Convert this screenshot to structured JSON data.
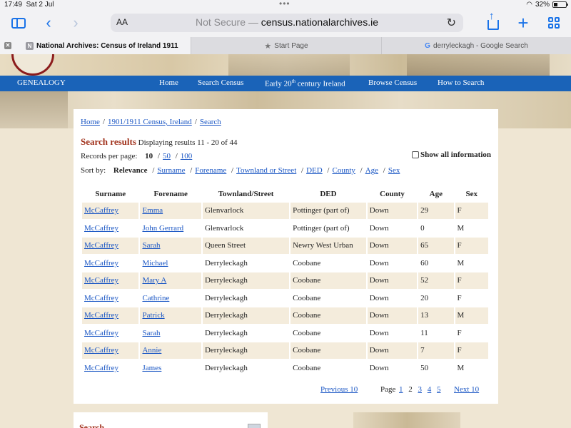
{
  "status_bar": {
    "time": "17:49",
    "date": "Sat 2 Jul",
    "battery": "32%"
  },
  "toolbar": {
    "aa_label": "AA",
    "url_prefix": "Not Secure —",
    "url_host": "census.nationalarchives.ie",
    "icons": [
      "sidebar-icon",
      "back-icon",
      "forward-icon",
      "reload-icon",
      "share-icon",
      "new-tab-icon",
      "tabs-overview-icon"
    ]
  },
  "tabs": [
    {
      "label": "National Archives: Census of Ireland 1911",
      "active": true
    },
    {
      "label": "Start Page",
      "active": false
    },
    {
      "label": "derryleckagh - Google Search",
      "active": false
    }
  ],
  "nav": {
    "genealogy": "GENEALOGY",
    "items": [
      "Home",
      "Search Census",
      "Early 20",
      "th",
      " century Ireland",
      "Browse Census",
      "How to Search"
    ]
  },
  "breadcrumb": [
    "Home",
    "1901/1911 Census, Ireland",
    "Search"
  ],
  "results": {
    "heading": "Search results",
    "info": "Displaying results 11 - 20 of 44"
  },
  "per_page": {
    "label": "Records per page:",
    "current": "10",
    "options": [
      "50",
      "100"
    ]
  },
  "show_all": "Show all information",
  "sort": {
    "label": "Sort by:",
    "current": "Relevance",
    "options": [
      "Surname",
      "Forename",
      "Townland or Street",
      "DED",
      "County",
      "Age",
      "Sex"
    ]
  },
  "table": {
    "headers": [
      "Surname",
      "Forename",
      "Townland/Street",
      "DED",
      "County",
      "Age",
      "Sex"
    ],
    "rows": [
      [
        "McCaffrey",
        "Emma",
        "Glenvarlock",
        "Pottinger (part of)",
        "Down",
        "29",
        "F"
      ],
      [
        "McCaffrey",
        "John Gerrard",
        "Glenvarlock",
        "Pottinger (part of)",
        "Down",
        "0",
        "M"
      ],
      [
        "McCaffrey",
        "Sarah",
        "Queen Street",
        "Newry West Urban",
        "Down",
        "65",
        "F"
      ],
      [
        "McCaffrey",
        "Michael",
        "Derryleckagh",
        "Coobane",
        "Down",
        "60",
        "M"
      ],
      [
        "McCaffrey",
        "Mary A",
        "Derryleckagh",
        "Coobane",
        "Down",
        "52",
        "F"
      ],
      [
        "McCaffrey",
        "Cathrine",
        "Derryleckagh",
        "Coobane",
        "Down",
        "20",
        "F"
      ],
      [
        "McCaffrey",
        "Patrick",
        "Derryleckagh",
        "Coobane",
        "Down",
        "13",
        "M"
      ],
      [
        "McCaffrey",
        "Sarah",
        "Derryleckagh",
        "Coobane",
        "Down",
        "11",
        "F"
      ],
      [
        "McCaffrey",
        "Annie",
        "Derryleckagh",
        "Coobane",
        "Down",
        "7",
        "F"
      ],
      [
        "McCaffrey",
        "James",
        "Derryleckagh",
        "Coobane",
        "Down",
        "50",
        "M"
      ]
    ]
  },
  "pager": {
    "prev": "Previous 10",
    "page_label": "Page",
    "pages": [
      "1",
      "2",
      "3",
      "4",
      "5"
    ],
    "current": "2",
    "next": "Next 10"
  },
  "lower_panel": {
    "title": "Search"
  }
}
